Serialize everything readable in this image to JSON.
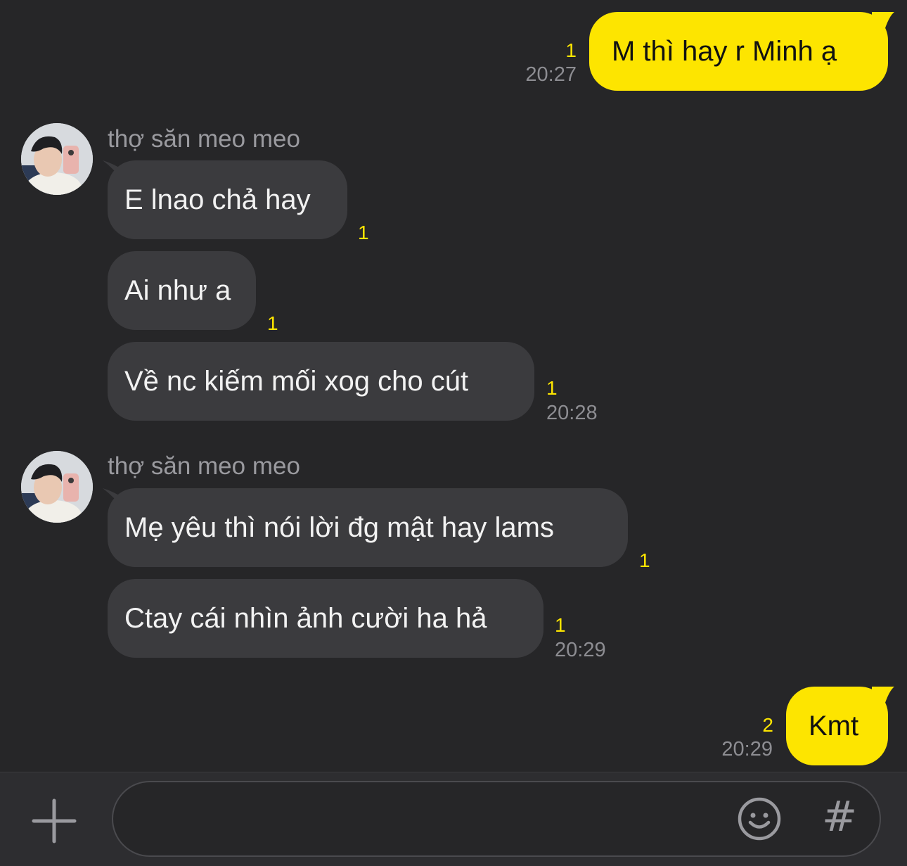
{
  "colors": {
    "background": "#262628",
    "my_bubble": "#fde500",
    "their_bubble": "#3b3b3e",
    "unread_count": "#fde500",
    "timestamp": "#8d8d92"
  },
  "messages": [
    {
      "from": "me",
      "text": "M thì hay r Minh ạ",
      "unread": "1",
      "time": "20:27"
    },
    {
      "from": "them",
      "sender": "thợ săn meo meo",
      "avatar": "avatar-photo",
      "text": "E lnao chả hay",
      "unread": "1"
    },
    {
      "from": "them",
      "text": "Ai như a",
      "unread": "1"
    },
    {
      "from": "them",
      "text": "Về nc kiếm mối xog cho cút",
      "unread": "1",
      "time": "20:28"
    },
    {
      "from": "them",
      "sender": "thợ săn meo meo",
      "avatar": "avatar-photo",
      "text": "Mẹ yêu thì nói lời đg mật hay lams",
      "unread": "1"
    },
    {
      "from": "them",
      "text": "Ctay cái nhìn ảnh cười ha hả",
      "unread": "1",
      "time": "20:29"
    },
    {
      "from": "me",
      "text": "Kmt",
      "unread": "2",
      "time": "20:29"
    }
  ],
  "input_bar": {
    "attach_icon": "plus-icon",
    "message_value": "",
    "emoji_icon": "smiley-icon",
    "hashtag_label": "#"
  }
}
